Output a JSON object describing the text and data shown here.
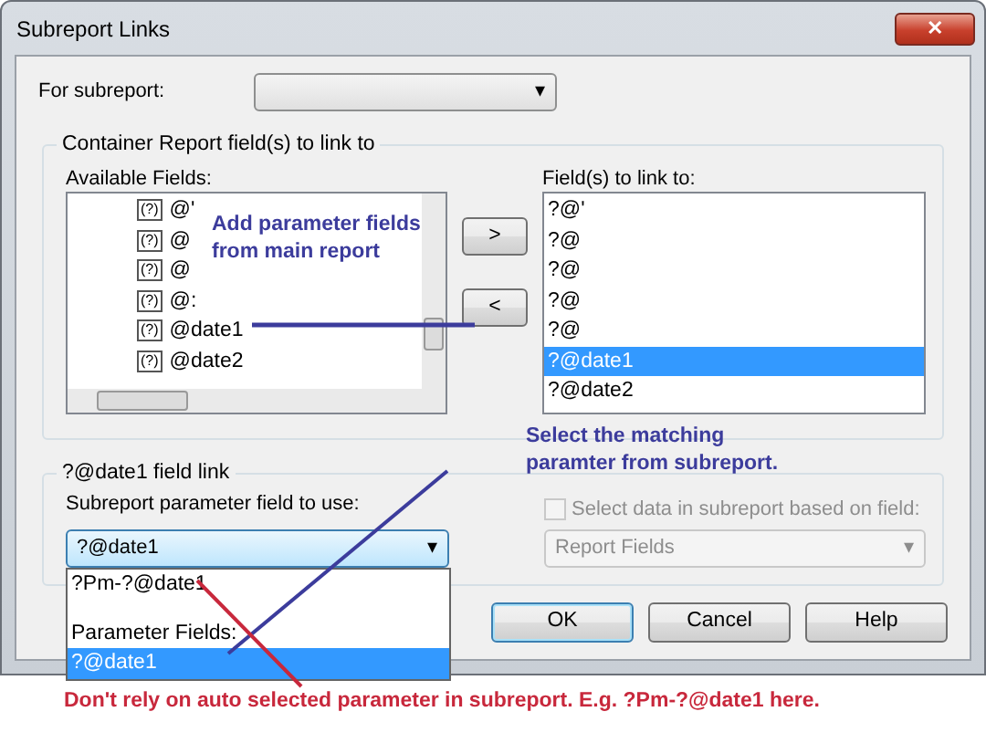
{
  "window": {
    "title": "Subreport Links",
    "close": "✕"
  },
  "for_subreport": {
    "label": "For subreport:",
    "arrow": "▾"
  },
  "container_group": {
    "title": "Container Report field(s) to link to",
    "available_fields": {
      "label": "Available Fields:",
      "items": [
        {
          "icon_text": "(?)",
          "text": "@'",
          "selected": false
        },
        {
          "icon_text": "(?)",
          "text": "@",
          "selected": false
        },
        {
          "icon_text": "(?)",
          "text": "@",
          "selected": false
        },
        {
          "icon_text": "(?)",
          "text": "@:",
          "selected": false
        },
        {
          "icon_text": "(?)",
          "text": "@date1",
          "selected": false
        },
        {
          "icon_text": "(?)",
          "text": "@date2",
          "selected": false
        }
      ]
    },
    "add_button": ">",
    "remove_button": "<",
    "linked_fields": {
      "label": "Field(s) to link to:",
      "items": [
        {
          "text": "?@'",
          "selected": false
        },
        {
          "text": "?@",
          "selected": false
        },
        {
          "text": "?@",
          "selected": false
        },
        {
          "text": "?@",
          "selected": false
        },
        {
          "text": "?@",
          "selected": false
        },
        {
          "text": "?@date1",
          "selected": true
        },
        {
          "text": "?@date2",
          "selected": false
        }
      ]
    }
  },
  "link_group": {
    "title": "?@date1 field link",
    "param_label": "Subreport parameter field to use:",
    "param_combo": {
      "value": "?@date1",
      "arrow": "▾",
      "expanded": true,
      "options": [
        {
          "kind": "option",
          "text": "?Pm-?@date1",
          "selected": false
        },
        {
          "kind": "spacer"
        },
        {
          "kind": "header",
          "text": "Parameter Fields:"
        },
        {
          "kind": "option",
          "text": "?@date1",
          "selected": true
        }
      ]
    },
    "select_data": {
      "label": "Select data in subreport based on field:",
      "checked": false,
      "disabled": true
    },
    "report_fields": {
      "value": "Report Fields",
      "arrow": "▾",
      "disabled": true
    }
  },
  "buttons": [
    {
      "label": "OK",
      "default": true
    },
    {
      "label": "Cancel",
      "default": false
    },
    {
      "label": "Help",
      "default": false
    }
  ],
  "annotations": [
    {
      "text": "Add parameter fields\nfrom main report",
      "color": "#3c3c9c"
    },
    {
      "text": "Select the matching\nparamter from subreport.",
      "color": "#3c3c9c"
    },
    {
      "text": "Don't rely on auto selected parameter in subreport. E.g. ?Pm-?@date1 here.",
      "color": "#c8283c"
    }
  ]
}
